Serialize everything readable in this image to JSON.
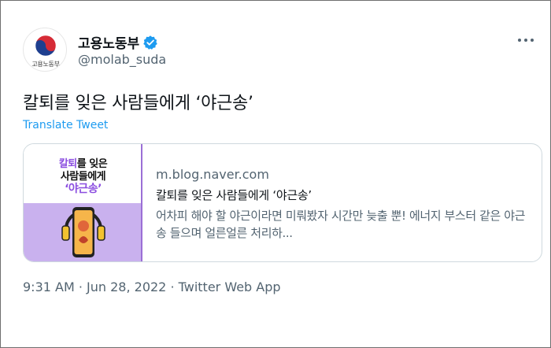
{
  "account": {
    "display_name": "고용노동부",
    "handle": "@molab_suda",
    "avatar_caption": "고용노동부"
  },
  "tweet": {
    "text": "칼퇴를 잊은 사람들에게 ‘야근송’",
    "translate_label": "Translate Tweet",
    "timestamp": "9:31 AM · Jun 28, 2022 · Twitter Web App"
  },
  "link_card": {
    "domain": "m.blog.naver.com",
    "title": "칼퇴를 잊은 사람들에게 ‘야근송’",
    "description": "어차피 해야 할 야근이라면 미뤄봤자 시간만 늦출 뿐! 에너지 부스터 같은 야근송 들으며 얼른얼른 처리하...",
    "thumbnail": {
      "line1_accent": "칼퇴",
      "line1_rest": "를 잊은",
      "line2": "사람들에게",
      "line3": "‘야근송’"
    }
  },
  "icons": {
    "verified": "verified-badge-icon",
    "more": "more-options-icon",
    "avatar_logo": "korea-taegeuk-logo"
  },
  "colors": {
    "link_blue": "#1d9bf0",
    "secondary_text": "#536471",
    "thumb_purple": "#c9b1ee",
    "thumb_accent": "#8c4fe0"
  }
}
